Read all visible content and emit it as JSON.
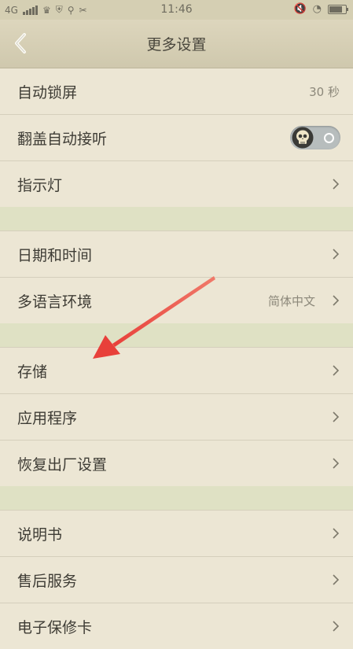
{
  "status_bar": {
    "network": "4G",
    "time": "11:46",
    "icons": [
      "signal-icon",
      "crown-icon",
      "android-icon",
      "usb-icon",
      "tools-icon",
      "mute-icon",
      "wifi-icon",
      "battery-icon"
    ]
  },
  "header": {
    "title": "更多设置"
  },
  "colors": {
    "background": "#ece6d4",
    "section_separator": "#dfe1c4",
    "title_bar": "#d5cfb3",
    "arrow": "#e8403a"
  },
  "sections": [
    [
      {
        "label": "自动锁屏",
        "value": "30 秒",
        "control": "value"
      },
      {
        "label": "翻盖自动接听",
        "control": "toggle",
        "toggle_on": false
      },
      {
        "label": "指示灯",
        "control": "chevron"
      }
    ],
    [
      {
        "label": "日期和时间",
        "control": "chevron"
      },
      {
        "label": "多语言环境",
        "value": "简体中文",
        "control": "chevron"
      }
    ],
    [
      {
        "label": "存储",
        "control": "chevron"
      },
      {
        "label": "应用程序",
        "control": "chevron"
      },
      {
        "label": "恢复出厂设置",
        "control": "chevron"
      }
    ],
    [
      {
        "label": "说明书",
        "control": "chevron"
      },
      {
        "label": "售后服务",
        "control": "chevron"
      },
      {
        "label": "电子保修卡",
        "control": "chevron"
      }
    ]
  ]
}
